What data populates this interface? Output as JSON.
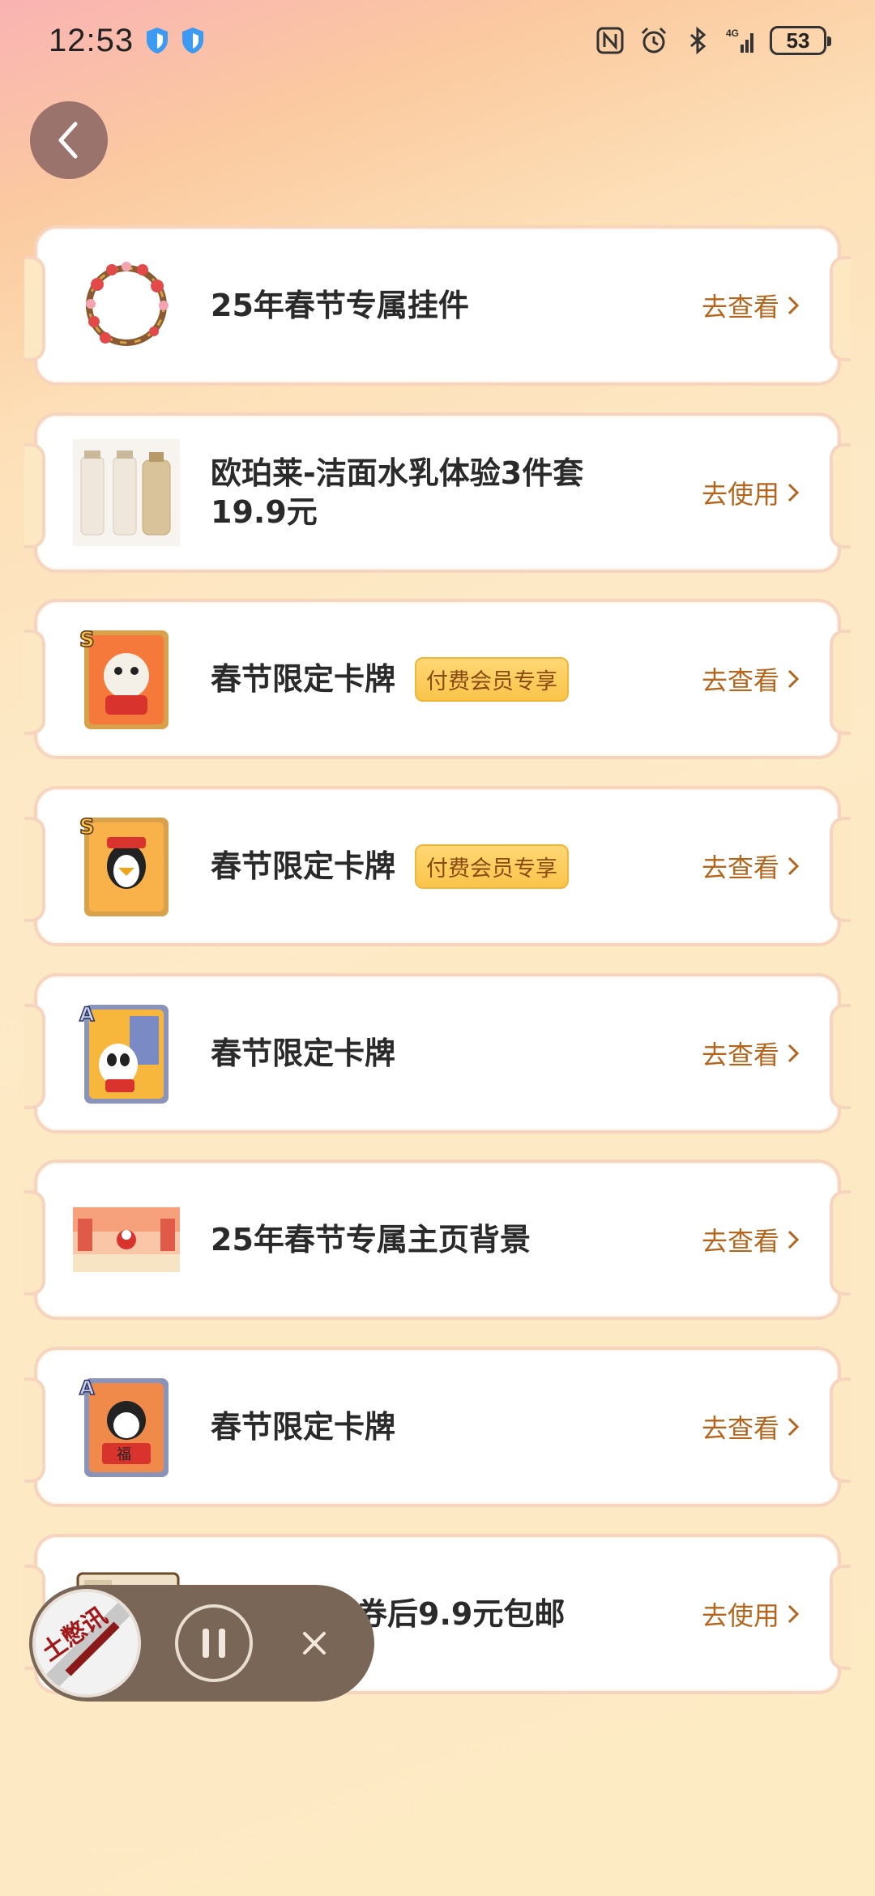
{
  "status_bar": {
    "time": "12:53",
    "battery": "53",
    "network": "4G"
  },
  "back_button": {
    "icon": "chevron-left-icon"
  },
  "items": [
    {
      "title": "25年春节专属挂件",
      "badge": "",
      "action": "去查看",
      "thumb": "wreath-icon"
    },
    {
      "title": "欧珀莱-洁面水乳体验3件套19.9元",
      "badge": "",
      "action": "去使用",
      "thumb": "skincare-bottles"
    },
    {
      "title": "春节限定卡牌",
      "badge": "付费会员专享",
      "action": "去查看",
      "thumb": "card-s-tiger"
    },
    {
      "title": "春节限定卡牌",
      "badge": "付费会员专享",
      "action": "去查看",
      "thumb": "card-s-penguin"
    },
    {
      "title": "春节限定卡牌",
      "badge": "",
      "action": "去查看",
      "thumb": "card-a-panda"
    },
    {
      "title": "25年春节专属主页背景",
      "badge": "",
      "action": "去查看",
      "thumb": "street-scene"
    },
    {
      "title": "春节限定卡牌",
      "badge": "",
      "action": "去查看",
      "thumb": "card-a-penguin"
    },
    {
      "title": "包券后9.9元包邮",
      "badge": "",
      "action": "去使用",
      "thumb": "food-package"
    }
  ],
  "player": {
    "cover_text": "土憋讯",
    "pause_icon": "pause-icon",
    "close_icon": "close-icon"
  },
  "colors": {
    "accent": "#b5651b",
    "badge": "#f9c54a",
    "player_bg": "#7a6657"
  }
}
